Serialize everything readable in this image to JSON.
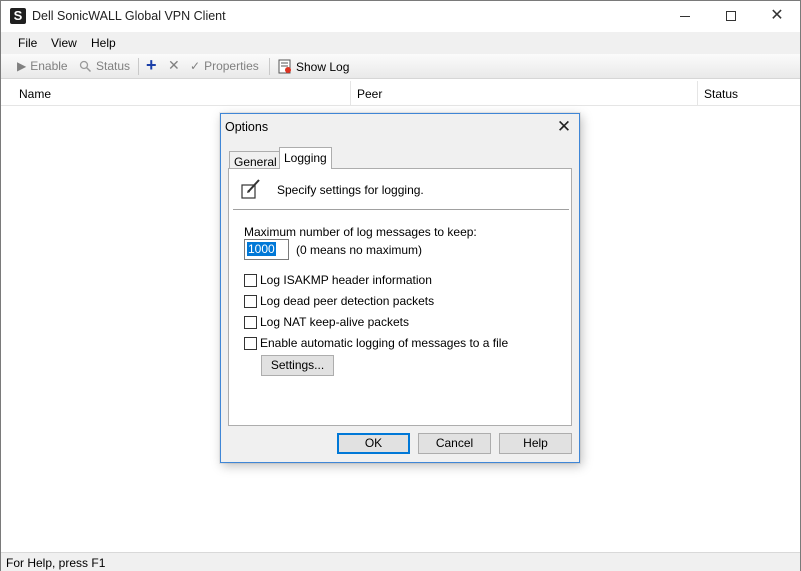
{
  "window": {
    "title": "Dell SonicWALL Global VPN Client",
    "app_icon_glyph": "S"
  },
  "menu": [
    "File",
    "View",
    "Help"
  ],
  "toolbar": {
    "enable": "Enable",
    "status": "Status",
    "properties": "Properties",
    "show_log": "Show Log",
    "add_icon": "+",
    "delete_icon": "✕",
    "check_icon": "✓"
  },
  "list_columns": [
    "Name",
    "Peer",
    "Status"
  ],
  "statusbar": {
    "text": "For Help, press F1"
  },
  "dialog": {
    "title": "Options",
    "tabs": [
      "General",
      "Logging"
    ],
    "active_tab": "Logging",
    "header_text": "Specify settings for logging.",
    "max_label": "Maximum number of log messages to keep:",
    "max_value": "1000",
    "max_hint": "(0 means no maximum)",
    "checkboxes": [
      {
        "label": "Log ISAKMP header information",
        "checked": false
      },
      {
        "label": "Log dead peer detection packets",
        "checked": false
      },
      {
        "label": "Log NAT keep-alive packets",
        "checked": false
      },
      {
        "label": "Enable automatic logging of messages to a file",
        "checked": false
      }
    ],
    "settings_button": "Settings...",
    "ok_button": "OK",
    "cancel_button": "Cancel",
    "help_button": "Help"
  },
  "colors": {
    "accent": "#0078d7",
    "dialog_border": "#3f86d6",
    "add_icon": "#1a3fa8"
  }
}
